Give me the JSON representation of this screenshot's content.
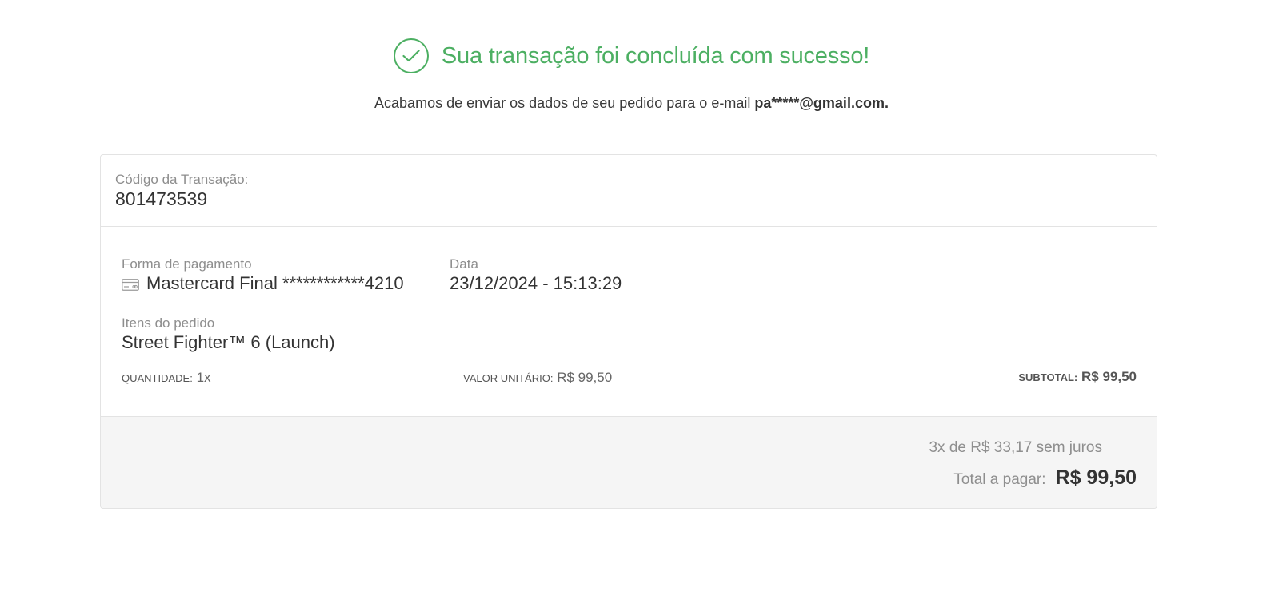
{
  "header": {
    "title": "Sua transação foi concluída com sucesso!",
    "icon": "check-circle-icon",
    "accent_color": "#4caf62"
  },
  "subtitle": {
    "text": "Acabamos de enviar os dados de seu pedido para o e-mail",
    "email": "pa*****@gmail.com."
  },
  "transaction": {
    "code_label": "Código da Transação:",
    "code_value": "801473539"
  },
  "payment": {
    "label": "Forma de pagamento",
    "icon": "credit-card-icon",
    "value": "Mastercard Final ************4210"
  },
  "date": {
    "label": "Data",
    "value": "23/12/2024 - 15:13:29"
  },
  "items": {
    "label": "Itens do pedido",
    "name": "Street Fighter™ 6 (Launch)",
    "quantity_label": "Quantidade:",
    "quantity_value": "1x",
    "unit_label": "Valor unitário:",
    "unit_value": "R$ 99,50",
    "subtotal_label": "Subtotal:",
    "subtotal_value": "R$ 99,50"
  },
  "summary": {
    "installments": "3x de R$ 33,17 sem juros",
    "total_label": "Total a pagar:",
    "total_value": "R$ 99,50"
  }
}
